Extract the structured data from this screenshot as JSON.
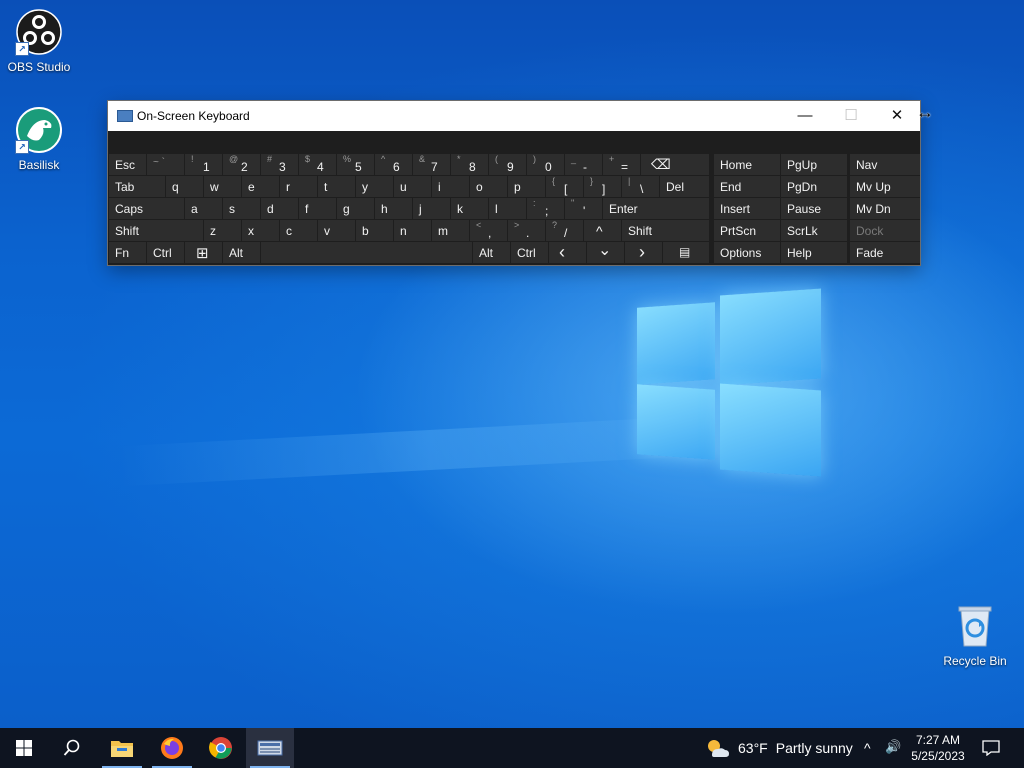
{
  "desktop": {
    "icons": [
      {
        "label": "OBS Studio",
        "icon": "obs-studio-icon"
      },
      {
        "label": "Basilisk",
        "icon": "basilisk-icon"
      },
      {
        "label": "Recycle Bin",
        "icon": "recycle-bin-icon"
      }
    ]
  },
  "osk": {
    "title": "On-Screen Keyboard",
    "title_icon": "keyboard-icon",
    "minimize_glyph": "—",
    "maximize_glyph": "☐",
    "close_glyph": "✕",
    "rows": {
      "row1": {
        "esc": "Esc",
        "tilde_sec": "~ `",
        "k1": {
          "sec": "!",
          "pri": "1"
        },
        "k2": {
          "sec": "@",
          "pri": "2"
        },
        "k3": {
          "sec": "#",
          "pri": "3"
        },
        "k4": {
          "sec": "$",
          "pri": "4"
        },
        "k5": {
          "sec": "%",
          "pri": "5"
        },
        "k6": {
          "sec": "^",
          "pri": "6"
        },
        "k7": {
          "sec": "&",
          "pri": "7"
        },
        "k8": {
          "sec": "*",
          "pri": "8"
        },
        "k9": {
          "sec": "(",
          "pri": "9"
        },
        "k0": {
          "sec": ")",
          "pri": "0"
        },
        "minus": {
          "sec": "_",
          "pri": "-"
        },
        "equals": {
          "sec": "+",
          "pri": "="
        },
        "backspace": "⌫"
      },
      "row2": {
        "tab": "Tab",
        "letters": [
          "q",
          "w",
          "e",
          "r",
          "t",
          "y",
          "u",
          "i",
          "o",
          "p"
        ],
        "lbracket": {
          "sec": "{",
          "pri": "["
        },
        "rbracket": {
          "sec": "}",
          "pri": "]"
        },
        "backslash": {
          "sec": "|",
          "pri": "\\"
        },
        "del": "Del"
      },
      "row3": {
        "caps": "Caps",
        "letters": [
          "a",
          "s",
          "d",
          "f",
          "g",
          "h",
          "j",
          "k",
          "l"
        ],
        "semicolon": {
          "sec": ":",
          "pri": ";"
        },
        "quote": {
          "sec": "\"",
          "pri": "'"
        },
        "enter": "Enter"
      },
      "row4": {
        "shift_left": "Shift",
        "letters": [
          "z",
          "x",
          "c",
          "v",
          "b",
          "n",
          "m"
        ],
        "comma": {
          "sec": "<",
          "pri": ","
        },
        "period": {
          "sec": ">",
          "pri": "."
        },
        "slash": {
          "sec": "?",
          "pri": "/"
        },
        "up": "^",
        "shift_right": "Shift"
      },
      "row5": {
        "fn": "Fn",
        "ctrl_left": "Ctrl",
        "win": "⊞",
        "alt_left": "Alt",
        "alt_right": "Alt",
        "ctrl_right": "Ctrl",
        "left": "‹",
        "down": "⌄",
        "right": "›",
        "menu": "▤"
      }
    },
    "nav_keys": {
      "home": "Home",
      "pgup": "PgUp",
      "nav": "Nav",
      "end": "End",
      "pgdn": "PgDn",
      "mvup": "Mv Up",
      "insert": "Insert",
      "pause": "Pause",
      "mvdn": "Mv Dn",
      "prtscn": "PrtScn",
      "scrlk": "ScrLk",
      "dock": "Dock",
      "options": "Options",
      "help": "Help",
      "fade": "Fade"
    }
  },
  "taskbar": {
    "start_icon": "windows-start-icon",
    "search_icon": "search-icon",
    "pinned": [
      "file-explorer-icon",
      "firefox-icon",
      "chrome-icon",
      "on-screen-keyboard-icon"
    ],
    "weather": {
      "temp": "63°F",
      "condition": "Partly sunny"
    },
    "clock": {
      "time": "7:27 AM",
      "date": "5/25/2023"
    },
    "tray": {
      "chevron": "^",
      "volume": "🔊"
    }
  }
}
